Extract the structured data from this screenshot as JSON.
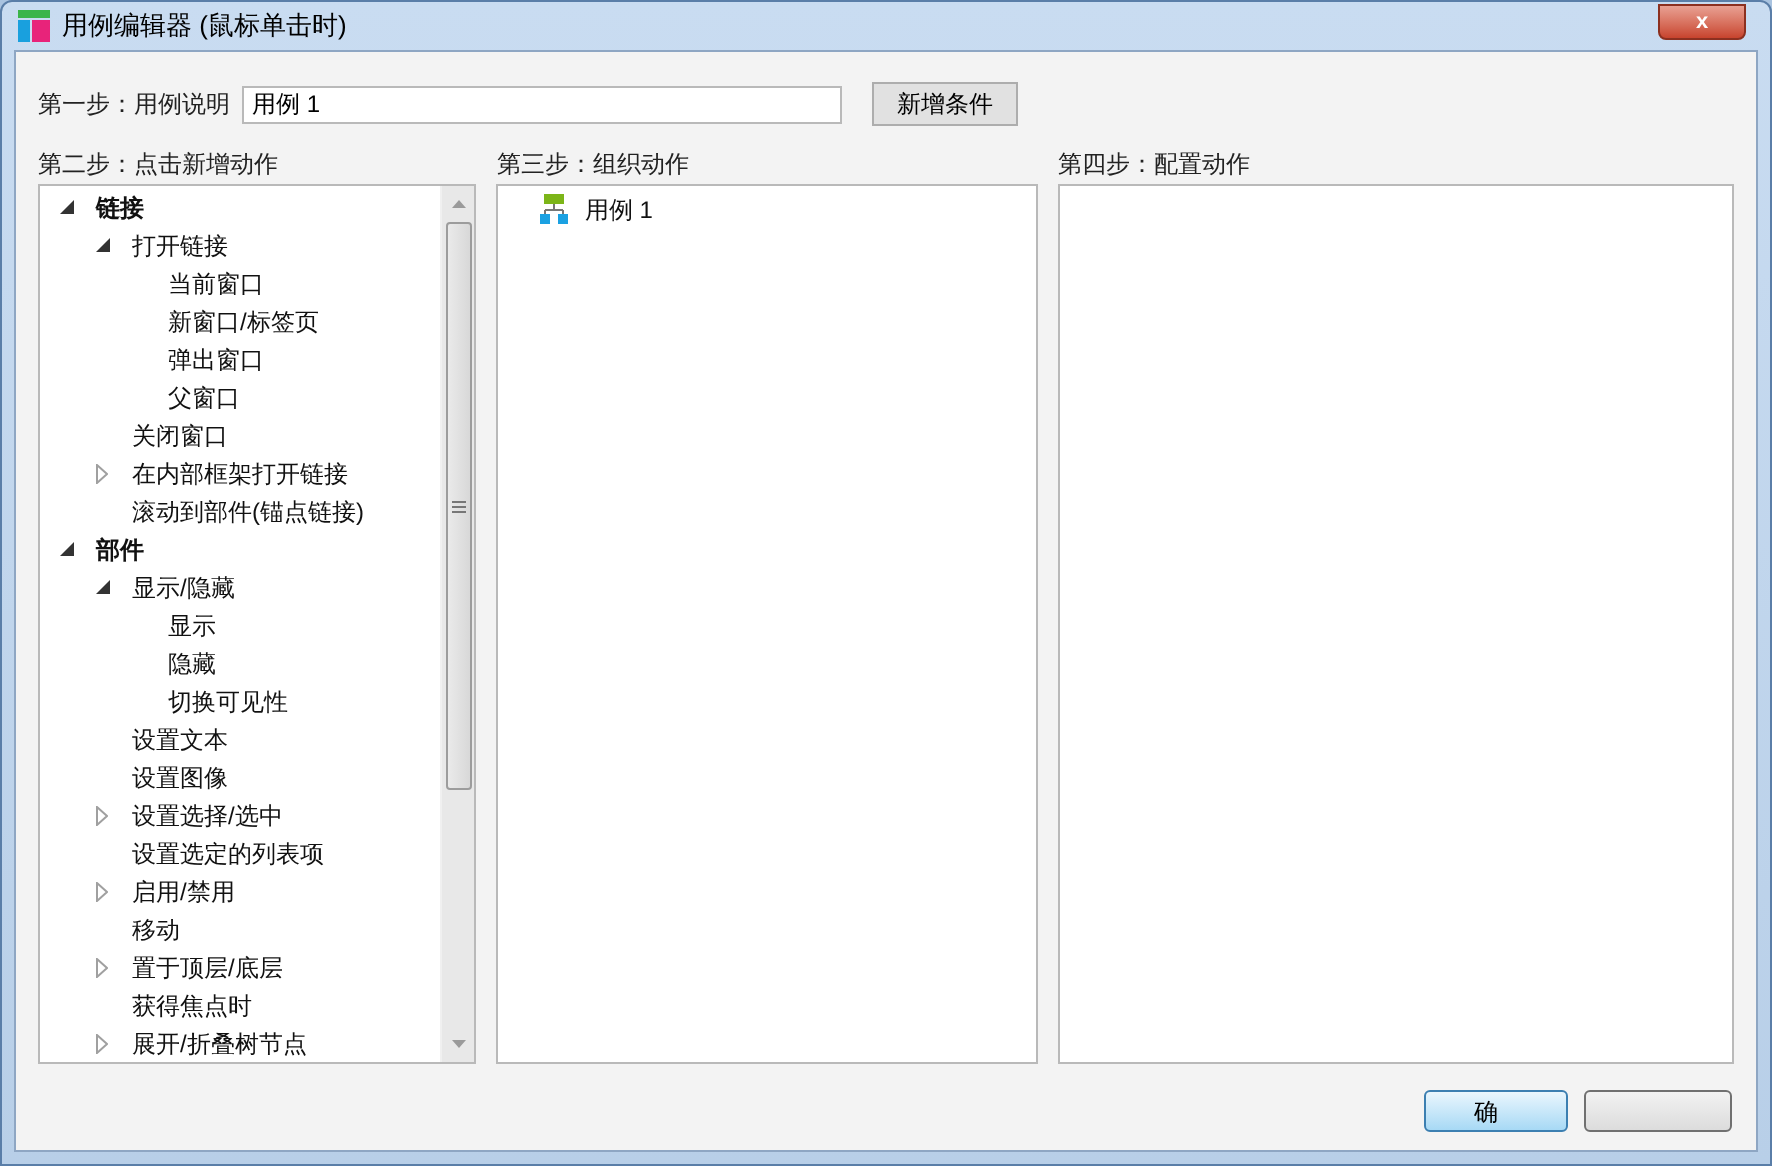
{
  "window": {
    "title": "用例编辑器 (鼠标单击时)",
    "close": "x"
  },
  "step1": {
    "label": "第一步：用例说明",
    "value": "用例 1",
    "button": "新增条件"
  },
  "step2": {
    "label": "第二步：点击新增动作",
    "tree": [
      {
        "kind": "node",
        "label": "链接",
        "expanded": true,
        "children": [
          {
            "kind": "node",
            "label": "打开链接",
            "expanded": true,
            "children": [
              {
                "kind": "leaf",
                "label": "当前窗口"
              },
              {
                "kind": "leaf",
                "label": "新窗口/标签页"
              },
              {
                "kind": "leaf",
                "label": "弹出窗口"
              },
              {
                "kind": "leaf",
                "label": "父窗口"
              }
            ]
          },
          {
            "kind": "leaf",
            "label": "关闭窗口"
          },
          {
            "kind": "node",
            "label": "在内部框架打开链接",
            "expanded": false
          },
          {
            "kind": "leaf",
            "label": "滚动到部件(锚点链接)"
          }
        ]
      },
      {
        "kind": "node",
        "label": "部件",
        "expanded": true,
        "children": [
          {
            "kind": "node",
            "label": "显示/隐藏",
            "expanded": true,
            "children": [
              {
                "kind": "leaf",
                "label": "显示"
              },
              {
                "kind": "leaf",
                "label": "隐藏"
              },
              {
                "kind": "leaf",
                "label": "切换可见性"
              }
            ]
          },
          {
            "kind": "leaf",
            "label": "设置文本"
          },
          {
            "kind": "leaf",
            "label": "设置图像"
          },
          {
            "kind": "node",
            "label": "设置选择/选中",
            "expanded": false
          },
          {
            "kind": "leaf",
            "label": "设置选定的列表项"
          },
          {
            "kind": "node",
            "label": "启用/禁用",
            "expanded": false
          },
          {
            "kind": "leaf",
            "label": "移动"
          },
          {
            "kind": "node",
            "label": "置于顶层/底层",
            "expanded": false
          },
          {
            "kind": "leaf",
            "label": "获得焦点时"
          },
          {
            "kind": "node",
            "label": "展开/折叠树节点",
            "expanded": false
          }
        ]
      }
    ]
  },
  "step3": {
    "label": "第三步：组织动作",
    "items": [
      {
        "label": "用例 1"
      }
    ]
  },
  "step4": {
    "label": "第四步：配置动作"
  },
  "buttons": [
    {
      "label": "确"
    },
    {
      "kind": "plain"
    }
  ]
}
